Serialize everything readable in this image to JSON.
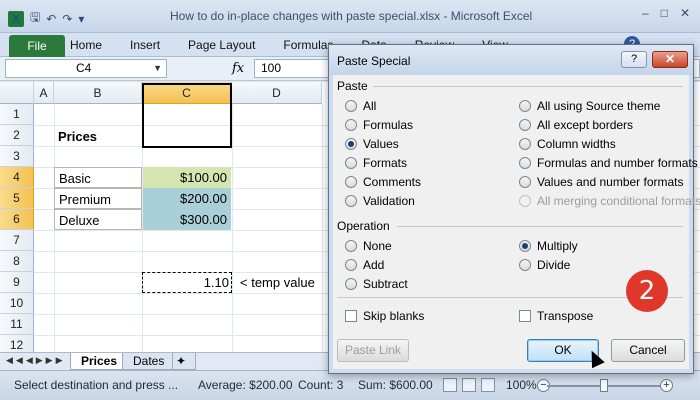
{
  "window": {
    "title": "How to do in-place changes with paste special.xlsx  -  Microsoft Excel",
    "app_icon": "X"
  },
  "ribbon": {
    "file_tab": "File",
    "tabs": [
      "Home",
      "Insert",
      "Page Layout",
      "Formulas",
      "Data",
      "Review",
      "View"
    ]
  },
  "formula_bar": {
    "name_box": "C4",
    "fx": "fx",
    "value": "100"
  },
  "columns": [
    "A",
    "B",
    "C",
    "D"
  ],
  "rows": [
    "1",
    "2",
    "3",
    "4",
    "5",
    "6",
    "7",
    "8",
    "9",
    "10",
    "11",
    "12"
  ],
  "sheet": {
    "heading": "Prices",
    "items": [
      {
        "name": "Basic",
        "price": "$100.00"
      },
      {
        "name": "Premium",
        "price": "$200.00"
      },
      {
        "name": "Deluxe",
        "price": "$300.00"
      }
    ],
    "temp_value": "1.10",
    "temp_label": "< temp value"
  },
  "sheet_tabs": [
    "Prices",
    "Dates"
  ],
  "status": {
    "message": "Select destination and press ...",
    "average": "Average: $200.00",
    "count": "Count: 3",
    "sum": "Sum: $600.00",
    "zoom": "100%"
  },
  "dialog": {
    "title": "Paste Special",
    "help_label": "?",
    "close_label": "✕",
    "paste_group": "Paste",
    "paste_left": [
      "All",
      "Formulas",
      "Values",
      "Formats",
      "Comments",
      "Validation"
    ],
    "paste_right": [
      "All using Source theme",
      "All except borders",
      "Column widths",
      "Formulas and number formats",
      "Values and number formats",
      "All merging conditional formats"
    ],
    "paste_selected": "Values",
    "operation_group": "Operation",
    "op_left": [
      "None",
      "Add",
      "Subtract"
    ],
    "op_right": [
      "Multiply",
      "Divide"
    ],
    "op_selected": "Multiply",
    "skip_blanks": "Skip blanks",
    "transpose": "Transpose",
    "paste_link": "Paste Link",
    "ok": "OK",
    "cancel": "Cancel"
  },
  "callout": "2"
}
